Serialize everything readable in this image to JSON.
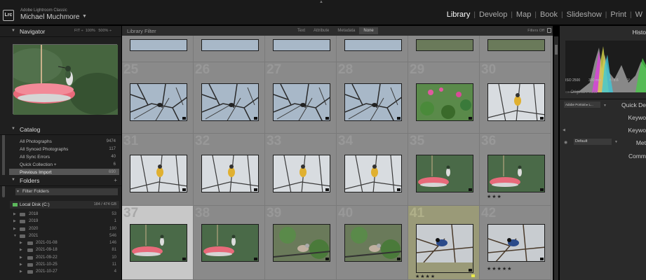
{
  "app": {
    "logo": "Lrc",
    "name": "Adobe Lightroom Classic",
    "user": "Michael Muchmore",
    "modules": [
      "Library",
      "Develop",
      "Map",
      "Book",
      "Slideshow",
      "Print",
      "W"
    ],
    "active_module": "Library"
  },
  "navigator": {
    "title": "Navigator",
    "opts": [
      "FIT",
      "100%",
      "500%"
    ]
  },
  "catalog": {
    "title": "Catalog",
    "items": [
      {
        "label": "All Photographs",
        "count": "9474"
      },
      {
        "label": "All Synced Photographs",
        "count": "117"
      },
      {
        "label": "All Sync Errors",
        "count": "40"
      },
      {
        "label": "Quick Collection +",
        "count": "6"
      },
      {
        "label": "Previous Import",
        "count": "690"
      }
    ]
  },
  "folders": {
    "title": "Folders",
    "filter_label": "Filter Folders",
    "volume": {
      "name": "Local Disk (C:)",
      "size": "184 / 474 GB"
    },
    "items": [
      {
        "label": "2018",
        "count": "53",
        "sub": false
      },
      {
        "label": "2019",
        "count": "1",
        "sub": false
      },
      {
        "label": "2020",
        "count": "190",
        "sub": false
      },
      {
        "label": "2021",
        "count": "546",
        "sub": false
      },
      {
        "label": "2021-01-08",
        "count": "146",
        "sub": true
      },
      {
        "label": "2021-09-18",
        "count": "81",
        "sub": true
      },
      {
        "label": "2021-09-22",
        "count": "10",
        "sub": true
      },
      {
        "label": "2021-10-25",
        "count": "11",
        "sub": true
      },
      {
        "label": "2021-10-27",
        "count": "4",
        "sub": true
      }
    ]
  },
  "library_filter": {
    "title": "Library Filter",
    "tabs": [
      "Text",
      "Attribute",
      "Metadata",
      "None"
    ],
    "active_tab": "None",
    "status": "Filters Off"
  },
  "grid": {
    "numbers": [
      "25",
      "26",
      "27",
      "28",
      "29",
      "30",
      "31",
      "32",
      "33",
      "34",
      "35",
      "36",
      "37",
      "38",
      "39",
      "40",
      "41",
      "42"
    ],
    "ratings": {
      "36": "★★★",
      "41": "★★★★",
      "42": "★★★★★"
    }
  },
  "right_panel": {
    "histogram_title": "Histo",
    "hist_info": [
      "ISO 2500",
      "300 mm",
      "f / 8.6",
      "1/"
    ],
    "original_photo": "Original Photo",
    "preset": "Adobe Portrait ▸ L...",
    "quick_develop": "Quick De",
    "keywording": "Keywo",
    "keyword_list": "Keywo",
    "metadata": "Met",
    "metadata_preset": "Default",
    "comments": "Comm"
  }
}
